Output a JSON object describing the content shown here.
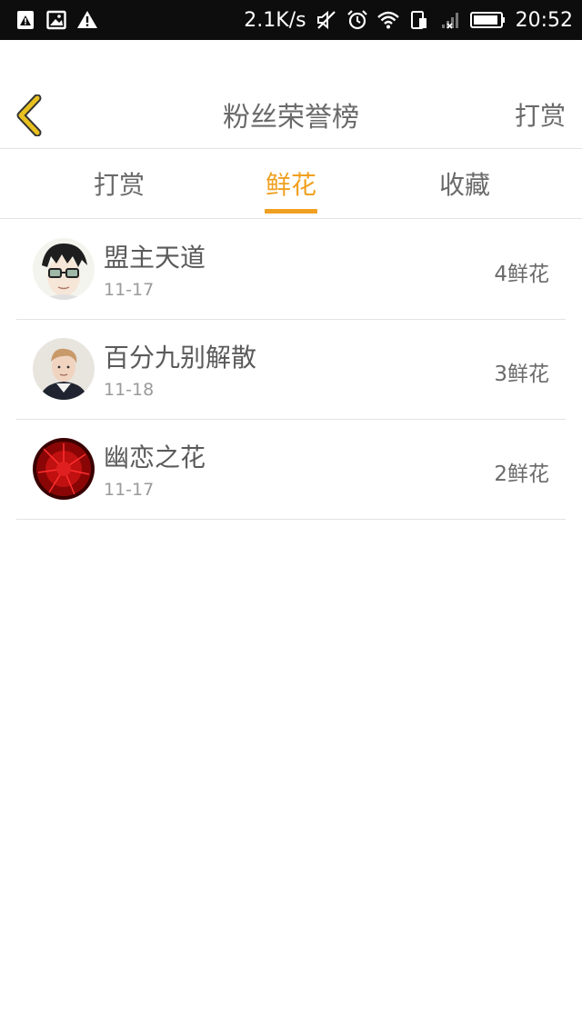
{
  "status_bar": {
    "speed": "2.1K/s",
    "time": "20:52",
    "icons": [
      "warning-image-icon",
      "image-icon",
      "alert-icon",
      "mute-icon",
      "alarm-icon",
      "wifi-icon",
      "sim-icon",
      "signal-icon",
      "battery-icon"
    ]
  },
  "header": {
    "title": "粉丝荣誉榜",
    "action_label": "打赏",
    "back_icon": "chevron-left-icon",
    "back_color": "#e8c020"
  },
  "tabs": [
    {
      "label": "打赏",
      "active": false
    },
    {
      "label": "鲜花",
      "active": true
    },
    {
      "label": "收藏",
      "active": false
    }
  ],
  "accent_color": "#f0a020",
  "fans": [
    {
      "name": "盟主天道",
      "date": "11-17",
      "amount": "4鲜花",
      "avatar": "anime-boy-glasses-avatar"
    },
    {
      "name": "百分九别解散",
      "date": "11-18",
      "amount": "3鲜花",
      "avatar": "young-man-photo-avatar"
    },
    {
      "name": "幽恋之花",
      "date": "11-17",
      "amount": "2鲜花",
      "avatar": "red-flower-avatar"
    }
  ]
}
